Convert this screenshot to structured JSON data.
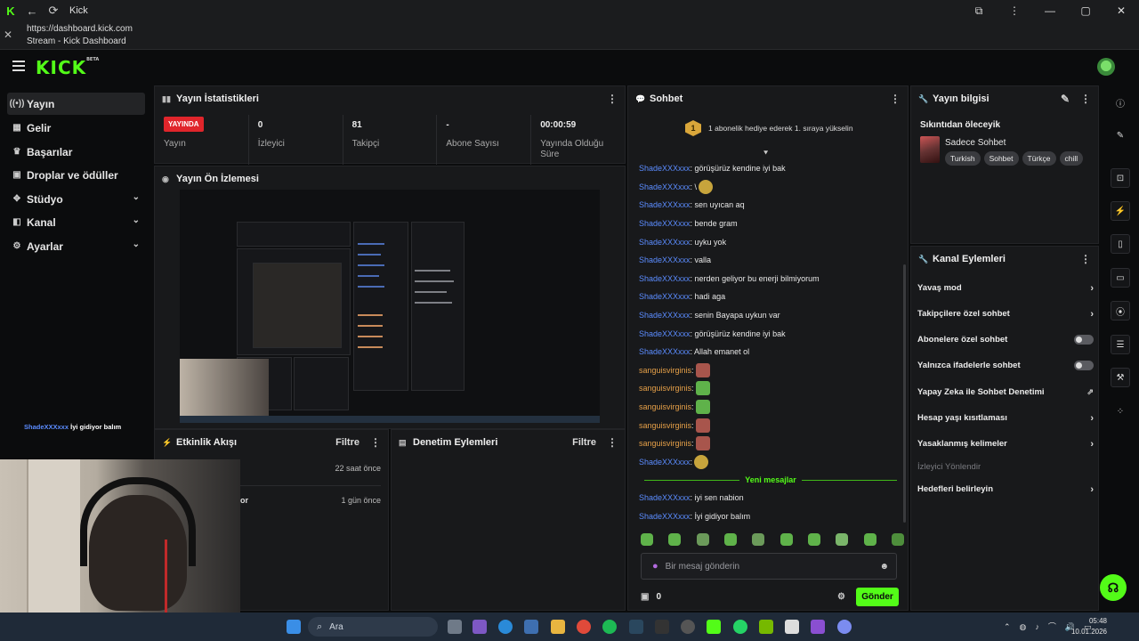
{
  "window": {
    "title": "Kick",
    "url": "https://dashboard.kick.com",
    "page_title": "Stream - Kick Dashboard"
  },
  "logo": {
    "text": "KICK",
    "badge": "BETA"
  },
  "sidebar": {
    "items": [
      {
        "label": "Yayın",
        "icon": "broadcast-icon",
        "active": true
      },
      {
        "label": "Gelir",
        "icon": "revenue-icon"
      },
      {
        "label": "Başarılar",
        "icon": "trophy-icon"
      },
      {
        "label": "Droplar ve ödüller",
        "icon": "gift-icon"
      },
      {
        "label": "Stüdyo",
        "icon": "studio-icon",
        "expandable": true
      },
      {
        "label": "Kanal",
        "icon": "channel-icon",
        "expandable": true
      },
      {
        "label": "Ayarlar",
        "icon": "gear-icon",
        "expandable": true
      }
    ]
  },
  "stats_panel": {
    "title": "Yayın İstatistikleri",
    "live_badge": "YAYINDA",
    "stats": [
      {
        "value": "",
        "label": "Yayın"
      },
      {
        "value": "0",
        "label": "İzleyici"
      },
      {
        "value": "81",
        "label": "Takipçi"
      },
      {
        "value": "-",
        "label": "Abone Sayısı"
      },
      {
        "value": "00:00:59",
        "label": "Yayında Olduğu Süre"
      }
    ]
  },
  "preview_panel": {
    "title": "Yayın Ön İzlemesi"
  },
  "activity_panel": {
    "title": "Etkinlik Akışı",
    "filter": "Filtre",
    "rows": [
      {
        "text": "",
        "time": "22 saat önce"
      },
      {
        "text": "or",
        "time": "1 gün önce"
      }
    ]
  },
  "moderation_panel": {
    "title": "Denetim Eylemleri",
    "filter": "Filtre"
  },
  "chat_panel": {
    "title": "Sohbet",
    "goal": {
      "badge": "1",
      "text": "1 abonelik hediye ederek 1. sıraya yükselin"
    },
    "messages": [
      {
        "user": "ShadeXXXxxx",
        "text": ": görüşürüz kendine iyi bak"
      },
      {
        "user": "ShadeXXXxxx",
        "text": ": \\ ",
        "emote": "yellow"
      },
      {
        "user": "ShadeXXXxxx",
        "text": ": sen uyıcan aq"
      },
      {
        "user": "ShadeXXXxxx",
        "text": ": bende gram"
      },
      {
        "user": "ShadeXXXxxx",
        "text": ": uyku yok"
      },
      {
        "user": "ShadeXXXxxx",
        "text": ": valla"
      },
      {
        "user": "ShadeXXXxxx",
        "text": ": nerden geliyor bu enerji bilmiyorum"
      },
      {
        "user": "ShadeXXXxxx",
        "text": ": hadi aga"
      },
      {
        "user": "ShadeXXXxxx",
        "text": ": senin Bayapa uykun var"
      },
      {
        "user": "ShadeXXXxxx",
        "text": ": görüşürüz kendine iyi bak"
      },
      {
        "user": "ShadeXXXxxx",
        "text": ": Allah emanet ol"
      },
      {
        "user": "sanguisvirginis",
        "gold": true,
        "text": ":",
        "emote": "red"
      },
      {
        "user": "sanguisvirginis",
        "gold": true,
        "text": ":",
        "emote": "green"
      },
      {
        "user": "sanguisvirginis",
        "gold": true,
        "text": ":",
        "emote": "green"
      },
      {
        "user": "sanguisvirginis",
        "gold": true,
        "text": ":",
        "emote": "red"
      },
      {
        "user": "sanguisvirginis",
        "gold": true,
        "text": ":",
        "emote": "red"
      },
      {
        "user": "ShadeXXXxxx",
        "text": ":",
        "emote": "yellow"
      }
    ],
    "new_messages_label": "Yeni mesajlar",
    "new_messages": [
      {
        "user": "ShadeXXXxxx",
        "text": ": iyi sen nabion"
      },
      {
        "user": "ShadeXXXxxx",
        "text": ": İyi gidiyor balım"
      }
    ],
    "input_placeholder": "Bir mesaj gönderin",
    "points": "0",
    "send_label": "Gönder"
  },
  "stream_info": {
    "title": "Yayın bilgisi",
    "stream_title": "Sıkıntıdan öleceyik",
    "category": "Sadece Sohbet",
    "tags": [
      "Turkish",
      "Sohbet",
      "Türkçe",
      "chill"
    ]
  },
  "channel_actions": {
    "title": "Kanal Eylemleri",
    "items": [
      {
        "label": "Yavaş mod",
        "control": "arrow"
      },
      {
        "label": "Takipçilere özel sohbet",
        "control": "arrow"
      },
      {
        "label": "Abonelere özel sohbet",
        "control": "toggle"
      },
      {
        "label": "Yalnızca ifadelerle sohbet",
        "control": "toggle"
      },
      {
        "label": "Yapay Zeka ile Sohbet Denetimi",
        "control": "external"
      },
      {
        "label": "Hesap yaşı kısıtlaması",
        "control": "arrow"
      },
      {
        "label": "Yasaklanmış kelimeler",
        "control": "arrow"
      },
      {
        "label": "İzleyici Yönlendir",
        "control": "none",
        "dim": true
      },
      {
        "label": "Hedefleri belirleyin",
        "control": "arrow"
      }
    ]
  },
  "overlay": {
    "user": "ShadeXXXxxx",
    "text": " İyi gidiyor balım"
  },
  "taskbar": {
    "search_placeholder": "Ara",
    "time": "05:48",
    "date": "10.01.2026"
  },
  "colors": {
    "accent": "#53fc18",
    "live": "#e0252b",
    "username": "#5b8cff",
    "username_alt": "#e6a048"
  }
}
